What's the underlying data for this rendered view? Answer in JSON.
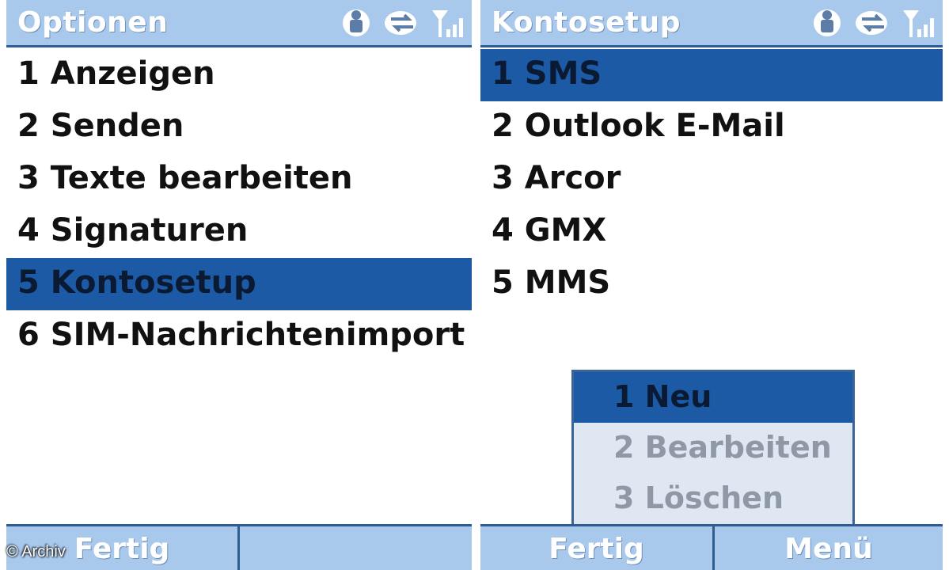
{
  "left_screen": {
    "title": "Optionen",
    "menu_items": [
      {
        "label": "1 Anzeigen",
        "selected": false
      },
      {
        "label": "2 Senden",
        "selected": false
      },
      {
        "label": "3 Texte bearbeiten",
        "selected": false
      },
      {
        "label": "4 Signaturen",
        "selected": false
      },
      {
        "label": "5 Kontosetup",
        "selected": true
      },
      {
        "label": "6 SIM-Nachrichtenimport",
        "selected": false
      }
    ],
    "softkey_left": "Fertig",
    "softkey_right": ""
  },
  "right_screen": {
    "title": "Kontosetup",
    "menu_items": [
      {
        "label": "1 SMS",
        "selected": true
      },
      {
        "label": "2 Outlook E-Mail",
        "selected": false
      },
      {
        "label": "3 Arcor",
        "selected": false
      },
      {
        "label": "4 GMX",
        "selected": false
      },
      {
        "label": "5 MMS",
        "selected": false
      }
    ],
    "popup_menu": [
      {
        "label": "1 Neu",
        "selected": true,
        "enabled": true
      },
      {
        "label": "2 Bearbeiten",
        "selected": false,
        "enabled": false
      },
      {
        "label": "3 Löschen",
        "selected": false,
        "enabled": false
      }
    ],
    "softkey_left": "Fertig",
    "softkey_right": "Menü"
  },
  "status_icons": [
    "activesync-icon",
    "data-connection-icon",
    "signal-strength-icon"
  ],
  "credit": "© Archiv",
  "colors": {
    "titlebar": "#a8c8ec",
    "border": "#2f5c92",
    "selection": "#1c5aa6",
    "popup_background": "#dfe7f2",
    "disabled_text": "#8f98a4"
  }
}
